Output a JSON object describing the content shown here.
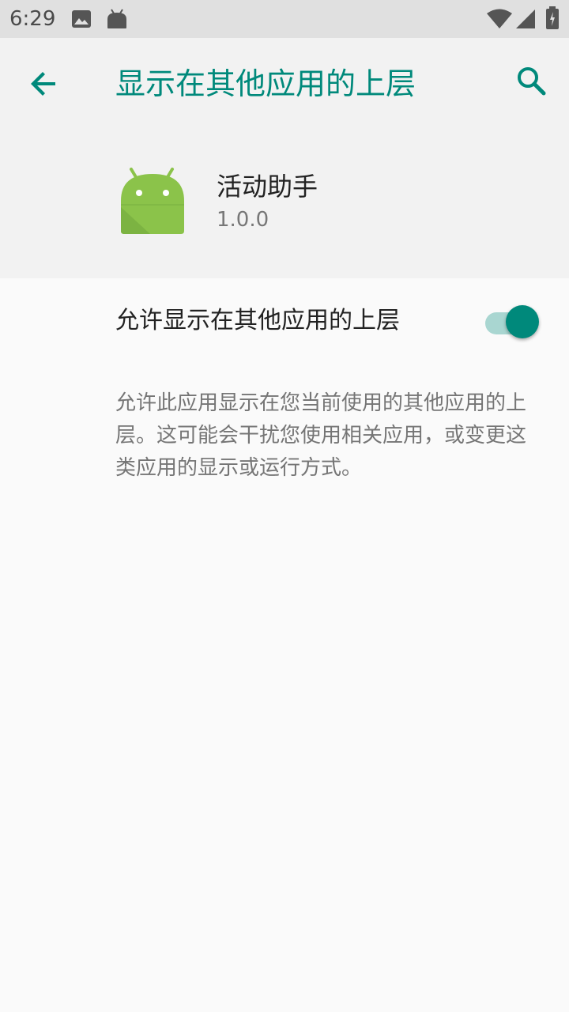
{
  "status_bar": {
    "time": "6:29",
    "icons": [
      "image-icon",
      "android-icon",
      "wifi-icon",
      "signal-icon",
      "battery-icon"
    ]
  },
  "header": {
    "title": "显示在其他应用的上层",
    "back_icon": "arrow-back-icon",
    "search_icon": "search-icon"
  },
  "app": {
    "name": "活动助手",
    "version": "1.0.0",
    "icon": "android-robot-icon"
  },
  "setting": {
    "label": "允许显示在其他应用的上层",
    "enabled": true
  },
  "description": "允许此应用显示在您当前使用的其他应用的上层。这可能会干扰您使用相关应用，或变更这类应用的显示或运行方式。",
  "colors": {
    "accent": "#00897b",
    "accent_light": "#a9d6d1",
    "android_green": "#8bc34a",
    "statusbar_bg": "#e0e0e0",
    "header_bg": "#f2f2f2",
    "page_bg": "#fafafa"
  }
}
